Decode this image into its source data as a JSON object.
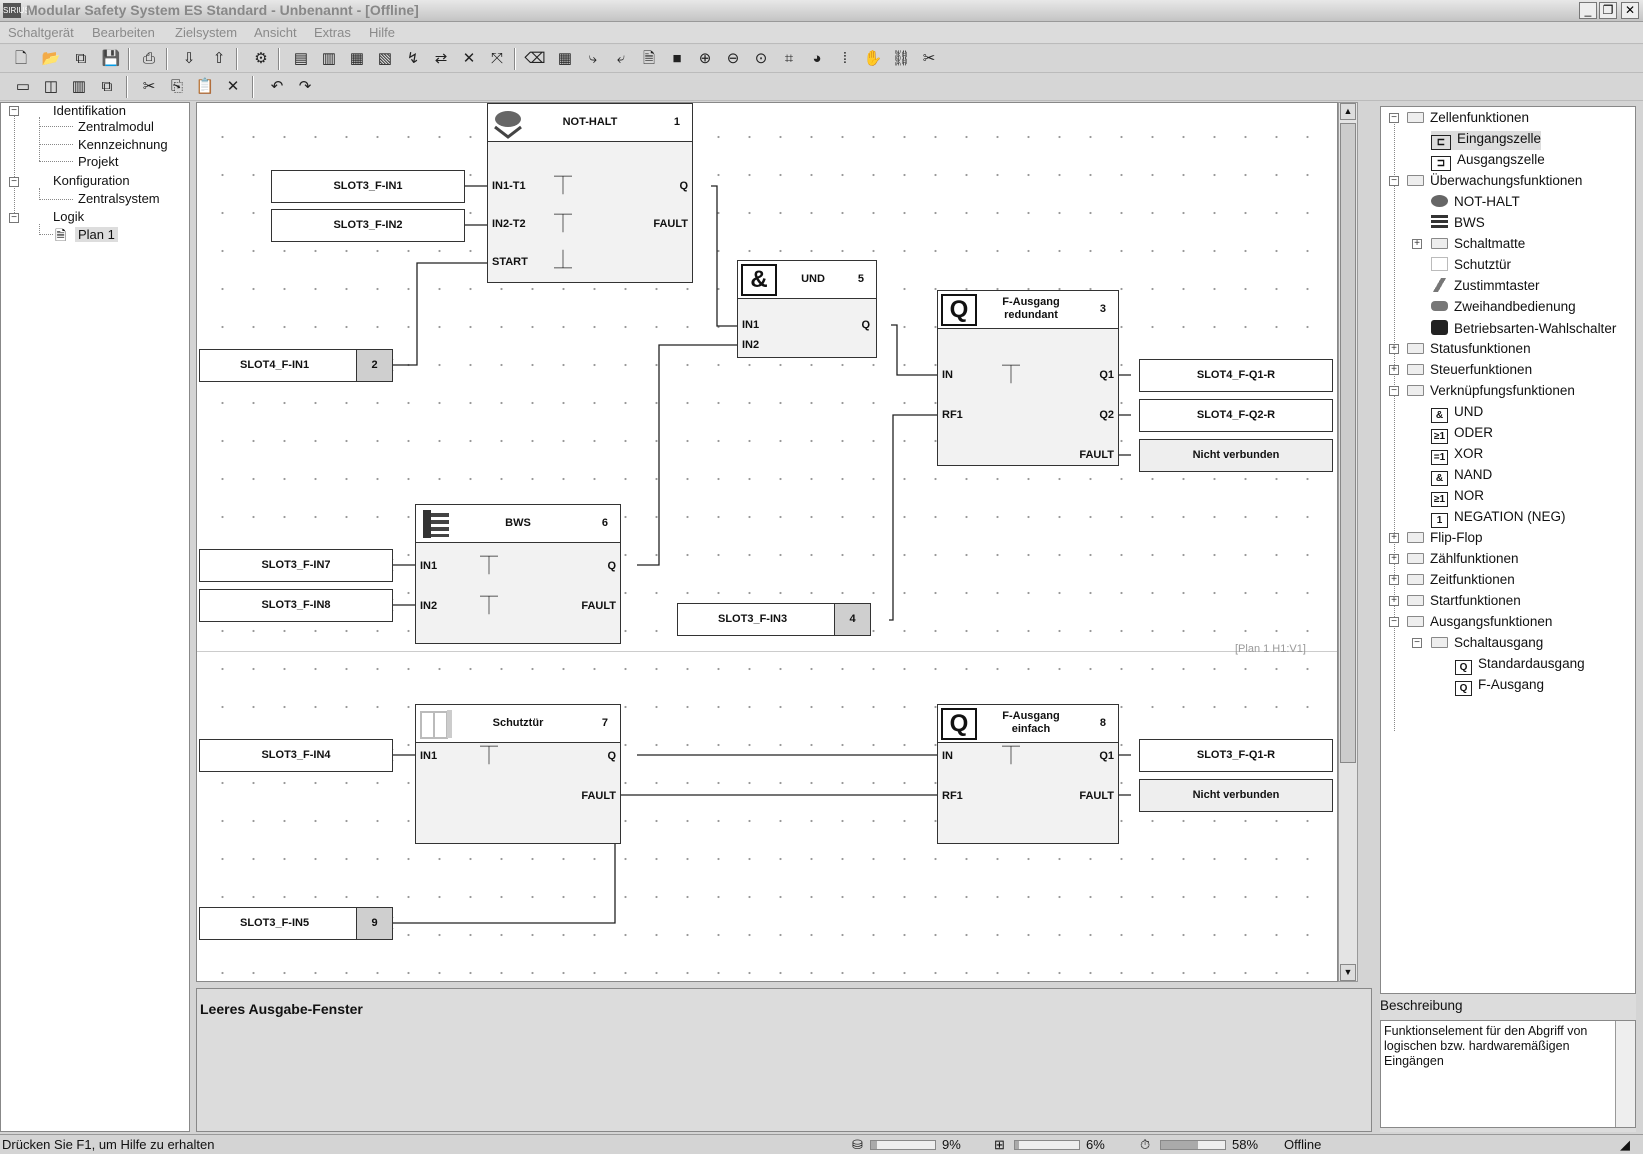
{
  "window": {
    "title": "Modular Safety System ES Standard - Unbenannt - [Offline]",
    "app_icon": "SIRIUS",
    "min_label": "_",
    "restore_label": "❐",
    "close_label": "✕"
  },
  "menu": [
    "Schaltgerät",
    "Bearbeiten",
    "Zielsystem",
    "Ansicht",
    "Extras",
    "Hilfe"
  ],
  "project_tree": {
    "identifikation": "Identifikation",
    "zentralmodul": "Zentralmodul",
    "kennzeichnung": "Kennzeichnung",
    "projekt": "Projekt",
    "konfiguration": "Konfiguration",
    "zentralsystem": "Zentralsystem",
    "logik": "Logik",
    "plan1": "Plan 1"
  },
  "blocks": {
    "not_halt": {
      "title": "NOT-HALT",
      "num": "1",
      "in1": "IN1-T1",
      "in2": "IN2-T2",
      "start": "START",
      "q": "Q",
      "fault": "FAULT"
    },
    "und": {
      "icon": "&",
      "title": "UND",
      "num": "5",
      "in1": "IN1",
      "in2": "IN2",
      "q": "Q"
    },
    "fa_red": {
      "icon": "Q",
      "title1": "F-Ausgang",
      "title2": "redundant",
      "num": "3",
      "in": "IN",
      "rf1": "RF1",
      "q1": "Q1",
      "q2": "Q2",
      "fault": "FAULT"
    },
    "bws": {
      "title": "BWS",
      "num": "6",
      "in1": "IN1",
      "in2": "IN2",
      "q": "Q",
      "fault": "FAULT"
    },
    "schutztuer": {
      "title": "Schutztür",
      "num": "7",
      "in1": "IN1",
      "q": "Q",
      "fault": "FAULT"
    },
    "fa_einf": {
      "icon": "Q",
      "title1": "F-Ausgang",
      "title2": "einfach",
      "num": "8",
      "in": "IN",
      "rf1": "RF1",
      "q1": "Q1",
      "fault": "FAULT"
    }
  },
  "tags": {
    "t_in1": "SLOT3_F-IN1",
    "t_in2": "SLOT3_F-IN2",
    "t_s4in1": "SLOT4_F-IN1",
    "t_s4in1_num": "2",
    "t_in7": "SLOT3_F-IN7",
    "t_in8": "SLOT3_F-IN8",
    "t_in3": "SLOT3_F-IN3",
    "t_in3_num": "4",
    "t_in4": "SLOT3_F-IN4",
    "t_in5": "SLOT3_F-IN5",
    "t_in5_num": "9",
    "o_q1r": "SLOT4_F-Q1-R",
    "o_q2r": "SLOT4_F-Q2-R",
    "o_nv1": "Nicht verbunden",
    "o_s3q1r": "SLOT3_F-Q1-R",
    "o_nv2": "Nicht verbunden"
  },
  "plan_label": "[Plan 1 H1:V1]",
  "output": {
    "title": "Leeres Ausgabe-Fenster"
  },
  "library": {
    "zellenfunktionen": "Zellenfunktionen",
    "eingangszelle": "Eingangszelle",
    "ausgangszelle": "Ausgangszelle",
    "ueberwachung": "Überwachungsfunktionen",
    "nothalt": "NOT-HALT",
    "bws": "BWS",
    "schaltmatte": "Schaltmatte",
    "schutztuer": "Schutztür",
    "zustimmtaster": "Zustimmtaster",
    "zweihand": "Zweihandbedienung",
    "betriebsarten": "Betriebsarten-Wahlschalter",
    "status": "Statusfunktionen",
    "steuer": "Steuerfunktionen",
    "verknuepf": "Verknüpfungsfunktionen",
    "und": "UND",
    "oder": "ODER",
    "xor": "XOR",
    "nand": "NAND",
    "nor": "NOR",
    "neg": "NEGATION (NEG)",
    "flipflop": "Flip-Flop",
    "zaehl": "Zählfunktionen",
    "zeit": "Zeitfunktionen",
    "start": "Startfunktionen",
    "ausgang": "Ausgangsfunktionen",
    "schaltausgang": "Schaltausgang",
    "standardausgang": "Standardausgang",
    "fausgang": "F-Ausgang",
    "icons": {
      "und": "&",
      "oder": "≥1",
      "xor": "=1",
      "nand": "&",
      "nor": "≥1",
      "neg": "1",
      "q": "Q"
    }
  },
  "description": {
    "header": "Beschreibung",
    "text": "Funktionselement für den Abgriff von logischen bzw. hardwaremäßigen Eingängen"
  },
  "status": {
    "help": "Drücken Sie F1, um Hilfe zu erhalten",
    "p1": "9%",
    "p2": "6%",
    "p3": "58%",
    "p1_value": 0.09,
    "p2_value": 0.06,
    "p3_value": 0.58,
    "mode": "Offline"
  }
}
